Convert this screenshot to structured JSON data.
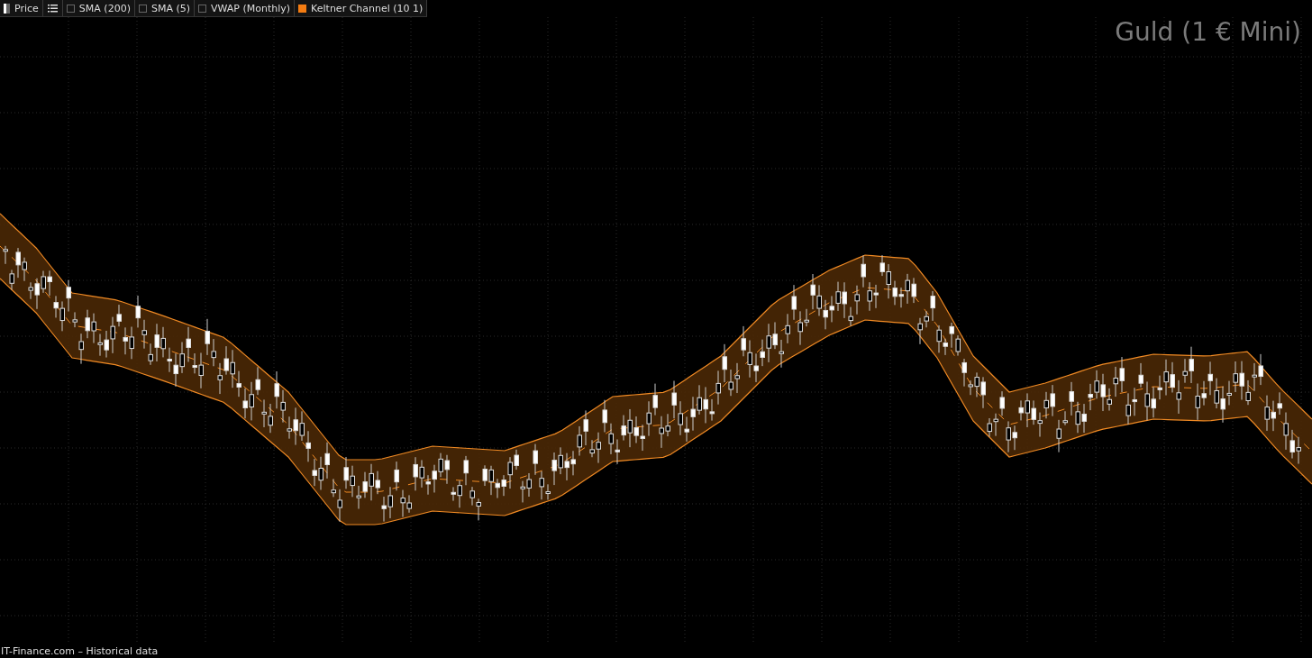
{
  "legend": [
    {
      "kind": "price",
      "label": "Price"
    },
    {
      "kind": "menu"
    },
    {
      "kind": "indicator",
      "label": "SMA (200)",
      "checked": false
    },
    {
      "kind": "indicator",
      "label": "SMA (5)",
      "checked": false
    },
    {
      "kind": "indicator",
      "label": "VWAP (Monthly)",
      "checked": false
    },
    {
      "kind": "indicator",
      "label": "Keltner Channel (10 1)",
      "checked": true
    }
  ],
  "title": "Guld (1 € Mini)",
  "footer": "IT-Finance.com – Historical data"
}
